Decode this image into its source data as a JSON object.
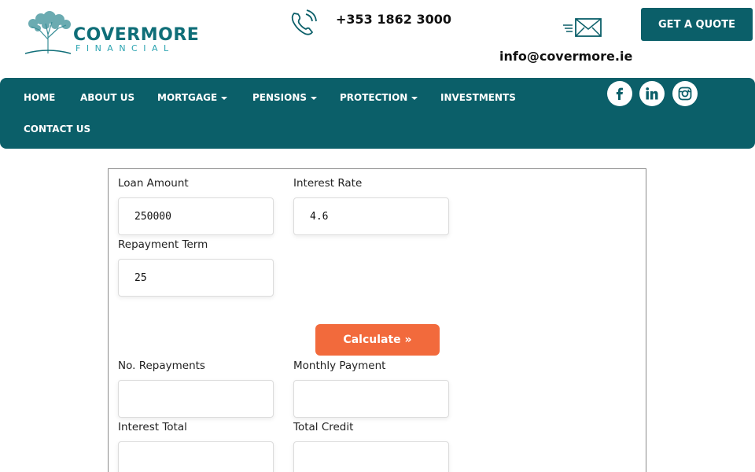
{
  "header": {
    "logo_word": "COVERMORE",
    "logo_sub": "FINANCIAL",
    "phone": "+353 1862 3000",
    "email": "info@covermore.ie",
    "quote_label": "GET A QUOTE"
  },
  "nav": {
    "items": [
      {
        "label": "HOME",
        "dropdown": false
      },
      {
        "label": "ABOUT US",
        "dropdown": false
      },
      {
        "label": "MORTGAGE",
        "dropdown": true
      },
      {
        "label": "PENSIONS",
        "dropdown": true
      },
      {
        "label": "PROTECTION",
        "dropdown": true
      },
      {
        "label": "INVESTMENTS",
        "dropdown": false
      },
      {
        "label": "CONTACT US",
        "dropdown": false
      }
    ],
    "social": [
      "facebook-icon",
      "linkedin-icon",
      "instagram-icon"
    ]
  },
  "calculator": {
    "loan_amount_label": "Loan Amount",
    "loan_amount_value": "250000",
    "interest_rate_label": "Interest Rate",
    "interest_rate_value": "4.6",
    "repayment_term_label": "Repayment Term",
    "repayment_term_value": "25",
    "calculate_label": "Calculate »",
    "repayments_label": "No. Repayments",
    "repayments_value": "",
    "monthly_label": "Monthly Payment",
    "monthly_value": "",
    "interest_total_label": "Interest Total",
    "interest_total_value": "",
    "total_credit_label": "Total Credit",
    "total_credit_value": ""
  },
  "colors": {
    "brand": "#0b5f69",
    "accent": "#f26a3c"
  }
}
